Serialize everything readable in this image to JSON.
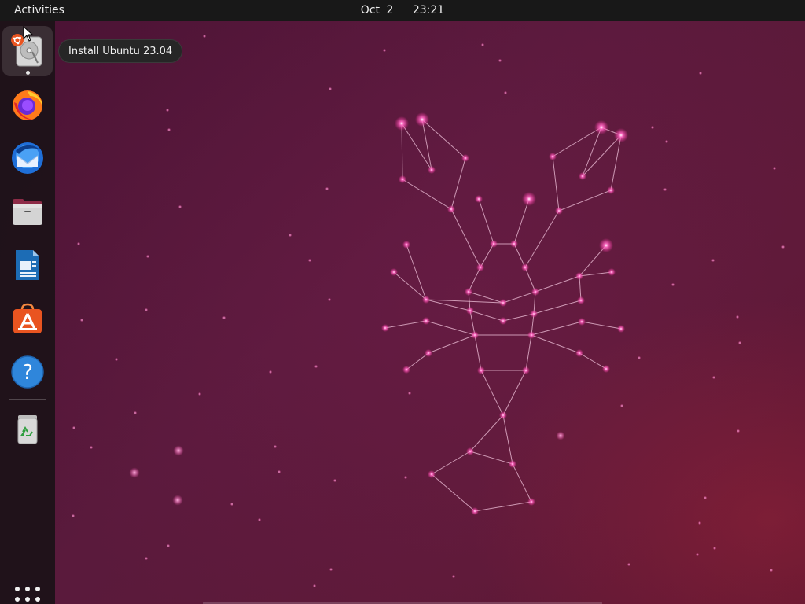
{
  "topbar": {
    "activities_label": "Activities",
    "clock_date": "Oct 2",
    "clock_time": "23:21"
  },
  "dock": {
    "items": [
      {
        "name": "install-ubuntu",
        "icon": "installer-disk-icon"
      },
      {
        "name": "firefox",
        "icon": "firefox-icon"
      },
      {
        "name": "thunderbird",
        "icon": "thunderbird-icon"
      },
      {
        "name": "files",
        "icon": "files-folder-icon"
      },
      {
        "name": "libreoffice-writer",
        "icon": "writer-document-icon"
      },
      {
        "name": "app-center",
        "icon": "app-center-bag-icon"
      },
      {
        "name": "help",
        "icon": "help-question-icon"
      },
      {
        "name": "trash",
        "icon": "trash-recycle-icon"
      }
    ],
    "show_apps_icon": "apps-grid-icon"
  },
  "tooltip": {
    "text": "Install Ubuntu 23.04"
  },
  "wallpaper": {
    "description_icon": "lobster-constellation-icon",
    "colors": {
      "background_dark": "#4a1234",
      "background_mid": "#5d1a38",
      "glow": "#ff4fb0",
      "line": "#f4c2de"
    }
  }
}
